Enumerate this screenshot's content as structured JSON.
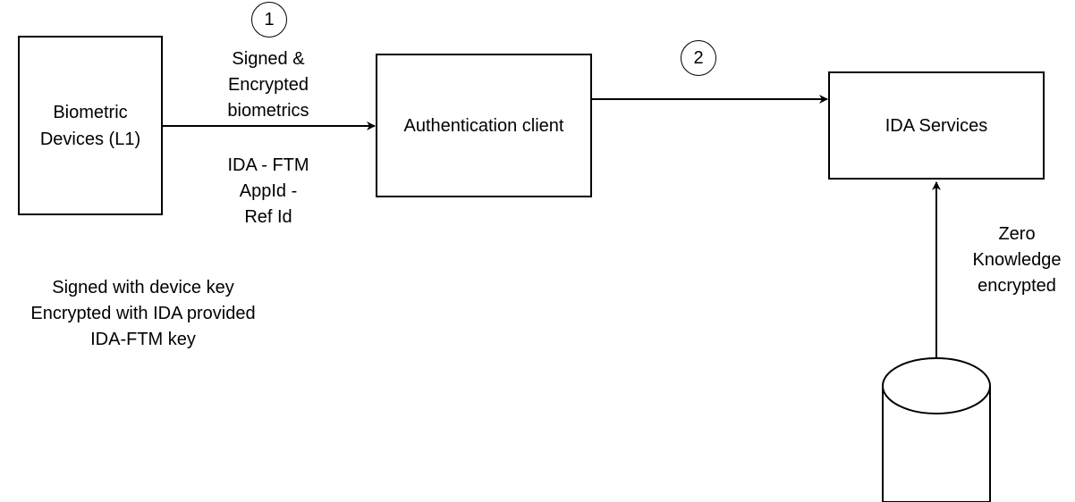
{
  "nodes": {
    "biometric_devices": {
      "lines": [
        "Biometric",
        "Devices (L1)"
      ]
    },
    "authentication_client": {
      "label": "Authentication client"
    },
    "ida_services": {
      "label": "IDA Services"
    },
    "database": {
      "label": ""
    }
  },
  "steps": {
    "step1": "1",
    "step2": "2"
  },
  "edge_labels": {
    "devices_to_client_top": [
      "Signed &",
      "Encrypted",
      "biometrics"
    ],
    "devices_to_client_bottom": [
      "IDA - FTM",
      "AppId -",
      "Ref Id"
    ],
    "database_to_ida": [
      "Zero",
      "Knowledge",
      "encrypted"
    ]
  },
  "notes": {
    "device_key_note": [
      "Signed with device key",
      "Encrypted with IDA provided",
      "IDA-FTM key"
    ]
  }
}
